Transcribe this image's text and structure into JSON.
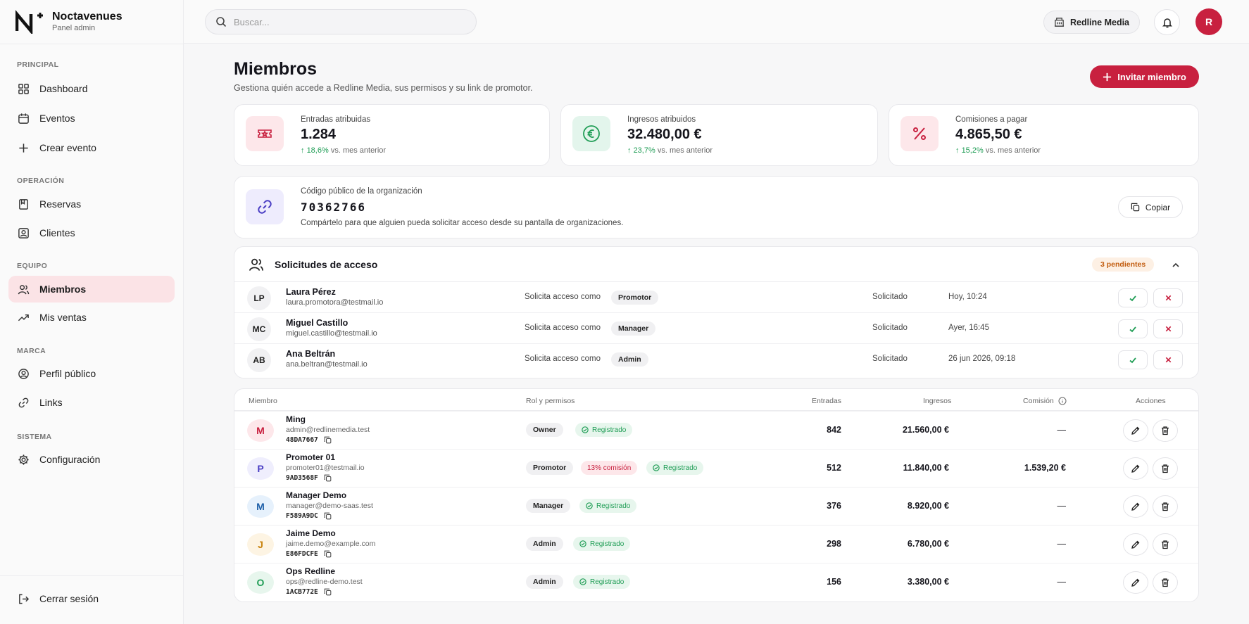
{
  "brand": {
    "name": "Noctavenues",
    "subtitle": "Panel admin"
  },
  "sidebar": {
    "sections": [
      {
        "title": "PRINCIPAL"
      },
      {
        "title": "OPERACIÓN"
      },
      {
        "title": "EQUIPO"
      },
      {
        "title": "MARCA"
      },
      {
        "title": "SISTEMA"
      }
    ],
    "items": [
      {
        "label": "Dashboard",
        "icon": "grid-icon"
      },
      {
        "label": "Eventos",
        "icon": "calendar-icon"
      },
      {
        "label": "Crear evento",
        "icon": "plus-icon"
      },
      {
        "label": "Reservas",
        "icon": "bookmark-icon"
      },
      {
        "label": "Clientes",
        "icon": "contact-icon"
      },
      {
        "label": "Miembros",
        "icon": "users-icon",
        "active": true
      },
      {
        "label": "Mis ventas",
        "icon": "trend-icon"
      },
      {
        "label": "Perfil público",
        "icon": "profile-icon"
      },
      {
        "label": "Links",
        "icon": "link-icon"
      },
      {
        "label": "Configuración",
        "icon": "gear-icon"
      }
    ],
    "logout": "Cerrar sesión"
  },
  "topbar": {
    "search_placeholder": "Buscar...",
    "organization": "Redline Media",
    "avatar_initial": "R"
  },
  "page": {
    "title": "Miembros",
    "subtitle": "Gestiona quién accede a Redline Media, sus permisos y su link de promotor.",
    "invite_label": "Invitar miembro"
  },
  "stats": [
    {
      "label": "Entradas atribuidas",
      "value": "1.284",
      "delta": "18,6%",
      "delta_suffix": "vs. mes anterior"
    },
    {
      "label": "Ingresos atribuidos",
      "value": "32.480,00 €",
      "delta": "23,7%",
      "delta_suffix": "vs. mes anterior"
    },
    {
      "label": "Comisiones a pagar",
      "value": "4.865,50 €",
      "delta": "15,2%",
      "delta_suffix": "vs. mes anterior"
    }
  ],
  "org_code": {
    "label": "Código público de la organización",
    "code": "70362766",
    "help": "Compártelo para que alguien pueda solicitar acceso desde su pantalla de organizaciones.",
    "copy_label": "Copiar"
  },
  "requests": {
    "title": "Solicitudes de acceso",
    "pending": "3 pendientes",
    "request_as_label": "Solicita acceso como",
    "status_label": "Solicitado",
    "rows": [
      {
        "initials": "LP",
        "name": "Laura Pérez",
        "email": "laura.promotora@testmail.io",
        "role": "Promotor",
        "date": "Hoy, 10:24"
      },
      {
        "initials": "MC",
        "name": "Miguel Castillo",
        "email": "miguel.castillo@testmail.io",
        "role": "Manager",
        "date": "Ayer, 16:45"
      },
      {
        "initials": "AB",
        "name": "Ana Beltrán",
        "email": "ana.beltran@testmail.io",
        "role": "Admin",
        "date": "26 jun 2026, 09:18"
      }
    ]
  },
  "members": {
    "columns": {
      "member": "Miembro",
      "role": "Rol y permisos",
      "entries": "Entradas",
      "revenue": "Ingresos",
      "commission": "Comisión",
      "actions": "Acciones"
    },
    "registered_label": "Registrado",
    "rows": [
      {
        "initial": "M",
        "name": "Ming",
        "email": "admin@redlinemedia.test",
        "code": "48DA7667",
        "role": "Owner",
        "commission_rate": "",
        "entries": "842",
        "revenue": "21.560,00 €",
        "commission": "—",
        "avatar_bg": "#fde7ea",
        "avatar_fg": "#c8203f"
      },
      {
        "initial": "P",
        "name": "Promoter 01",
        "email": "promoter01@testmail.io",
        "code": "9AD3568F",
        "role": "Promotor",
        "commission_rate": "13% comisión",
        "entries": "512",
        "revenue": "11.840,00 €",
        "commission": "1.539,20 €",
        "avatar_bg": "#efeefd",
        "avatar_fg": "#4b3fc4"
      },
      {
        "initial": "M",
        "name": "Manager Demo",
        "email": "manager@demo-saas.test",
        "code": "F589A9DC",
        "role": "Manager",
        "commission_rate": "",
        "entries": "376",
        "revenue": "8.920,00 €",
        "commission": "—",
        "avatar_bg": "#e6f1fc",
        "avatar_fg": "#1e5fa8"
      },
      {
        "initial": "J",
        "name": "Jaime Demo",
        "email": "jaime.demo@example.com",
        "code": "E86FDCFE",
        "role": "Admin",
        "commission_rate": "",
        "entries": "298",
        "revenue": "6.780,00 €",
        "commission": "—",
        "avatar_bg": "#fdf4e3",
        "avatar_fg": "#c98410"
      },
      {
        "initial": "O",
        "name": "Ops Redline",
        "email": "ops@redline-demo.test",
        "code": "1ACB772E",
        "role": "Admin",
        "commission_rate": "",
        "entries": "156",
        "revenue": "3.380,00 €",
        "commission": "—",
        "avatar_bg": "#e7f6ed",
        "avatar_fg": "#1f9d55"
      }
    ]
  },
  "colors": {
    "accent": "#c8203f",
    "success": "#1f9d55"
  }
}
